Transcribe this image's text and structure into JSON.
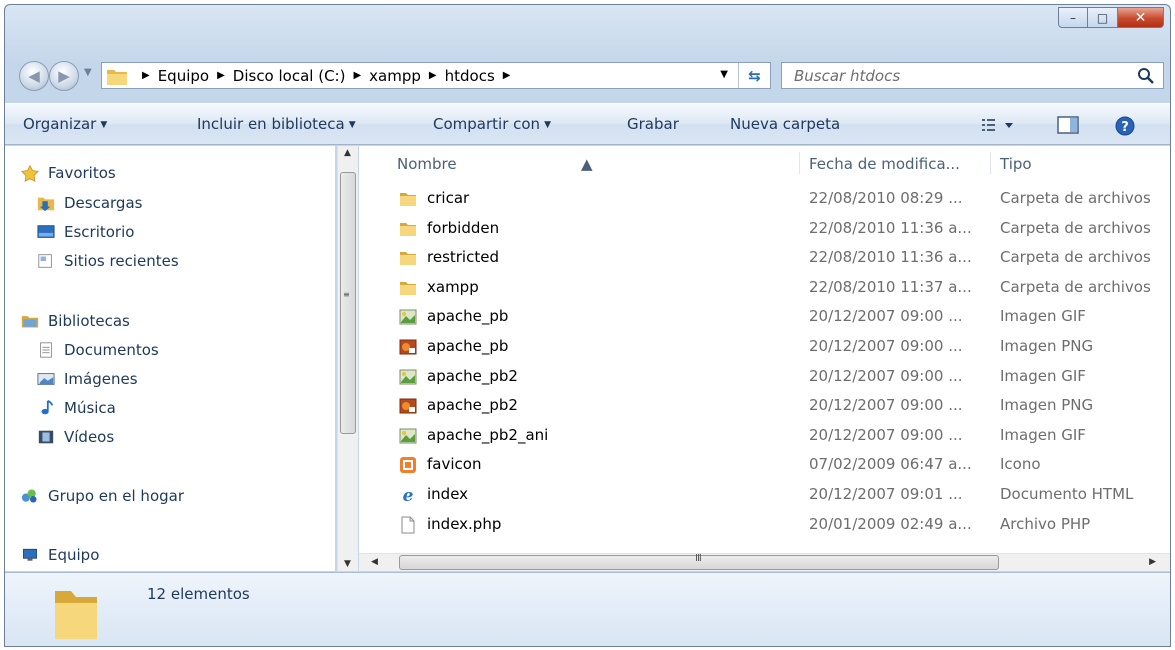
{
  "window": {
    "caption": {
      "minimize": "–",
      "maximize": "□",
      "close": "✕"
    }
  },
  "address_bar": {
    "crumbs": [
      "Equipo",
      "Disco local (C:)",
      "xampp",
      "htdocs"
    ]
  },
  "search": {
    "placeholder": "Buscar htdocs"
  },
  "toolbar": {
    "organize": "Organizar",
    "include_library": "Incluir en biblioteca",
    "share_with": "Compartir con",
    "burn": "Grabar",
    "new_folder": "Nueva carpeta"
  },
  "navigation": {
    "favorites": {
      "label": "Favoritos",
      "items": [
        "Descargas",
        "Escritorio",
        "Sitios recientes"
      ]
    },
    "libraries": {
      "label": "Bibliotecas",
      "items": [
        "Documentos",
        "Imágenes",
        "Música",
        "Vídeos"
      ]
    },
    "homegroup": "Grupo en el hogar",
    "computer": "Equipo"
  },
  "columns": {
    "name": "Nombre",
    "date": "Fecha de modifica...",
    "type": "Tipo"
  },
  "files": [
    {
      "icon": "folder-icon",
      "name": "cricar",
      "date": "22/08/2010 08:29 ...",
      "type": "Carpeta de archivos"
    },
    {
      "icon": "folder-icon",
      "name": "forbidden",
      "date": "22/08/2010 11:36 a...",
      "type": "Carpeta de archivos"
    },
    {
      "icon": "folder-icon",
      "name": "restricted",
      "date": "22/08/2010 11:36 a...",
      "type": "Carpeta de archivos"
    },
    {
      "icon": "folder-icon",
      "name": "xampp",
      "date": "22/08/2010 11:37 a...",
      "type": "Carpeta de archivos"
    },
    {
      "icon": "gif-image-icon",
      "name": "apache_pb",
      "date": "20/12/2007 09:00 ...",
      "type": "Imagen GIF"
    },
    {
      "icon": "png-image-icon",
      "name": "apache_pb",
      "date": "20/12/2007 09:00 ...",
      "type": "Imagen PNG"
    },
    {
      "icon": "gif-image-icon",
      "name": "apache_pb2",
      "date": "20/12/2007 09:00 ...",
      "type": "Imagen GIF"
    },
    {
      "icon": "png-image-icon",
      "name": "apache_pb2",
      "date": "20/12/2007 09:00 ...",
      "type": "Imagen PNG"
    },
    {
      "icon": "gif-image-icon",
      "name": "apache_pb2_ani",
      "date": "20/12/2007 09:00 ...",
      "type": "Imagen GIF"
    },
    {
      "icon": "favicon-icon",
      "name": "favicon",
      "date": "07/02/2009 06:47 a...",
      "type": "Icono"
    },
    {
      "icon": "ie-html-icon",
      "name": "index",
      "date": "20/12/2007 09:01 ...",
      "type": "Documento HTML"
    },
    {
      "icon": "blank-file-icon",
      "name": "index.php",
      "date": "20/01/2009 02:49 a...",
      "type": "Archivo PHP"
    }
  ],
  "hscroll": {
    "grip": "III"
  },
  "status": {
    "count": "12 elementos"
  },
  "colors": {
    "accent": "#1e395b",
    "close_button": "#c74b2e",
    "folder": "#f3cf6b"
  }
}
